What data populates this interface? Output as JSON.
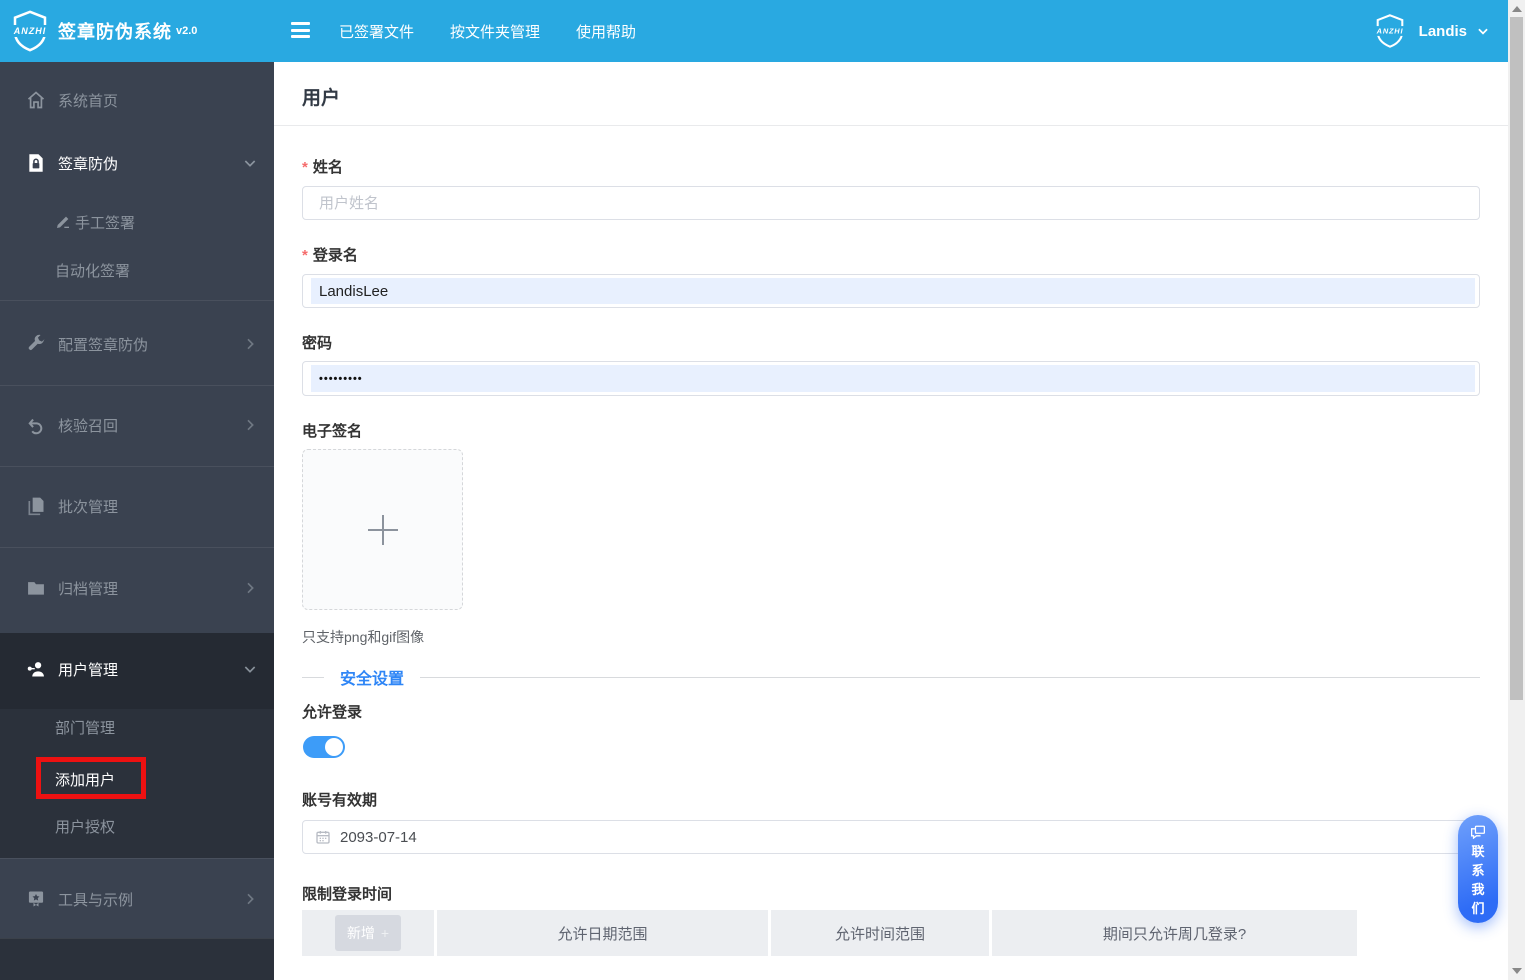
{
  "app": {
    "logo_text": "ANZHI",
    "title": "签章防伪系统",
    "version": "v2.0"
  },
  "topnav": {
    "items": [
      {
        "label": "已签署文件"
      },
      {
        "label": "按文件夹管理"
      },
      {
        "label": "使用帮助"
      }
    ],
    "user": {
      "name": "Landis"
    }
  },
  "sidebar": {
    "items": [
      {
        "label": "系统首页",
        "icon": "home-icon"
      },
      {
        "label": "签章防伪",
        "icon": "file-lock-icon",
        "state": "expanded"
      },
      {
        "label": "手工签署",
        "icon": "pen-icon",
        "sub": true
      },
      {
        "label": "自动化签署",
        "sub": true
      },
      {
        "label": "配置签章防伪",
        "icon": "wrench-icon",
        "state": "collapsed"
      },
      {
        "label": "核验召回",
        "icon": "undo-icon",
        "state": "collapsed"
      },
      {
        "label": "批次管理",
        "icon": "pages-icon"
      },
      {
        "label": "归档管理",
        "icon": "folder-icon",
        "state": "collapsed"
      },
      {
        "label": "用户管理",
        "icon": "user-key-icon",
        "state": "expanded",
        "selected": true
      },
      {
        "label": "部门管理",
        "sub": true
      },
      {
        "label": "添加用户",
        "sub": true,
        "highlighted": "red-annotation-box"
      },
      {
        "label": "用户授权",
        "sub": true
      },
      {
        "label": "工具与示例",
        "icon": "badge-icon",
        "state": "collapsed"
      }
    ]
  },
  "main": {
    "page_title": "用户",
    "fields": {
      "name": {
        "required_mark": "*",
        "label": "姓名",
        "placeholder": "用户姓名",
        "value": ""
      },
      "login": {
        "required_mark": "*",
        "label": "登录名",
        "value": "LandisLee"
      },
      "password": {
        "label": "密码",
        "masked_value": "•••••••••"
      },
      "esign": {
        "label": "电子签名",
        "hint": "只支持png和gif图像"
      },
      "security_section": {
        "title": "安全设置"
      },
      "allow_login": {
        "label": "允许登录",
        "state": "on"
      },
      "validity": {
        "label": "账号有效期",
        "value": "2093-07-14"
      },
      "restrict": {
        "label": "限制登录时间",
        "add_button": "新增",
        "add_plus": "+",
        "columns": [
          "允许日期范围",
          "允许时间范围",
          "期间只允许周几登录?"
        ]
      }
    }
  },
  "contact": {
    "label": "联系我们"
  },
  "colors": {
    "topbar_blue": "#29a9e1",
    "sidebar_bg": "#3a4250",
    "sidebar_selected_bg": "#2b313b",
    "accent_blue": "#2f86f6",
    "toggle_on_blue": "#3d9cf8",
    "autofill_bg": "#e8f0fe",
    "required_red": "#f56c6c",
    "annotation_red": "#ed1111",
    "contact_gradient": [
      "#6fa0fb",
      "#2e6cf6"
    ]
  }
}
